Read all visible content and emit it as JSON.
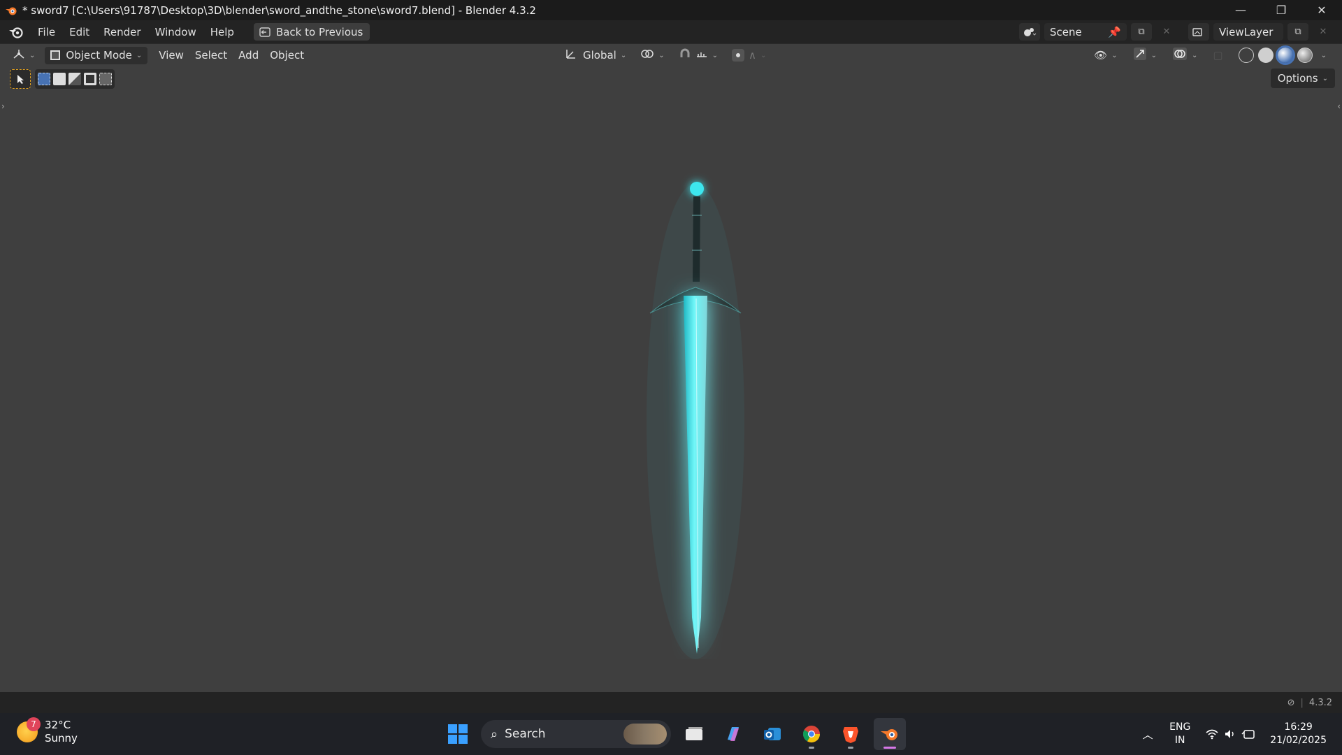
{
  "window": {
    "title": "* sword7 [C:\\Users\\91787\\Desktop\\3D\\blender\\sword_andthe_stone\\sword7.blend] - Blender 4.3.2",
    "minimize": "—",
    "restore": "❐",
    "close": "✕"
  },
  "menubar": {
    "items": [
      "File",
      "Edit",
      "Render",
      "Window",
      "Help"
    ],
    "back_button": "Back to Previous"
  },
  "scene": {
    "name": "Scene",
    "view_layer": "ViewLayer"
  },
  "viewport_header": {
    "mode": "Object Mode",
    "menus": [
      "View",
      "Select",
      "Add",
      "Object"
    ],
    "transform_orientation": "Global",
    "options": "Options"
  },
  "statusbar": {
    "version": "4.3.2"
  },
  "taskbar": {
    "weather_temp": "32°C",
    "weather_desc": "Sunny",
    "weather_badge": "7",
    "search_placeholder": "Search",
    "lang": "ENG",
    "region": "IN",
    "time": "16:29",
    "date": "21/02/2025"
  },
  "colors": {
    "viewport_bg": "#3f3f3f",
    "blade_glow": "#37e0e6",
    "accent_blue": "#4772b3"
  }
}
